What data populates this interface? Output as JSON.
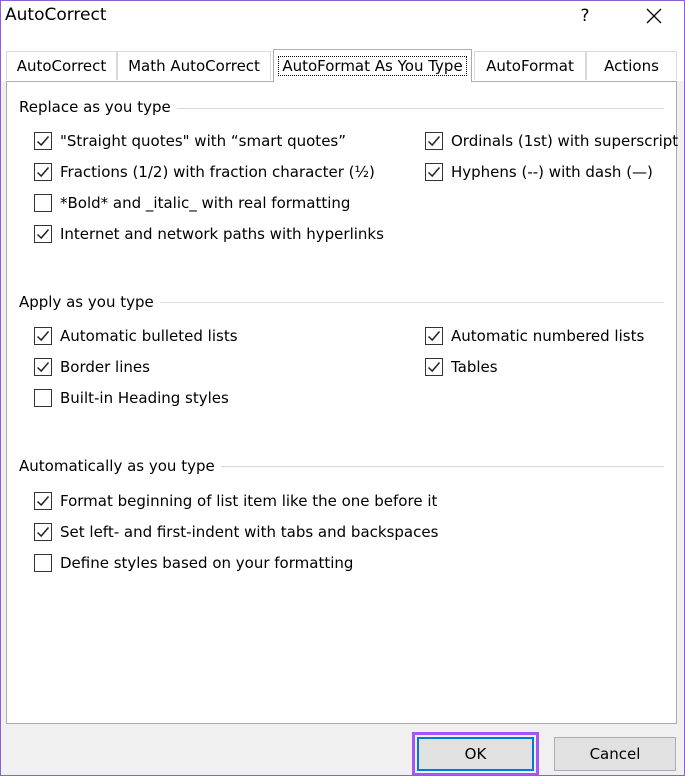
{
  "window": {
    "title": "AutoCorrect",
    "help_label": "?"
  },
  "tabs": [
    {
      "label": "AutoCorrect",
      "active": false
    },
    {
      "label": "Math AutoCorrect",
      "active": false
    },
    {
      "label": "AutoFormat As You Type",
      "active": true
    },
    {
      "label": "AutoFormat",
      "active": false
    },
    {
      "label": "Actions",
      "active": false
    }
  ],
  "groups": {
    "replace": {
      "title": "Replace as you type",
      "options": [
        {
          "label": "\"Straight quotes\" with “smart quotes”",
          "checked": true
        },
        {
          "label": "Fractions (1/2) with fraction character (½)",
          "checked": true
        },
        {
          "label": "*Bold* and _italic_ with real formatting",
          "checked": false
        },
        {
          "label": "Internet and network paths with hyperlinks",
          "checked": true
        },
        {
          "label": "Ordinals (1st) with superscript",
          "checked": true
        },
        {
          "label": "Hyphens (--) with dash (—)",
          "checked": true
        }
      ]
    },
    "apply": {
      "title": "Apply as you type",
      "options": [
        {
          "label": "Automatic bulleted lists",
          "checked": true
        },
        {
          "label": "Border lines",
          "checked": true
        },
        {
          "label": "Built-in Heading styles",
          "checked": false
        },
        {
          "label": "Automatic numbered lists",
          "checked": true
        },
        {
          "label": "Tables",
          "checked": true
        }
      ]
    },
    "auto": {
      "title": "Automatically as you type",
      "options": [
        {
          "label": "Format beginning of list item like the one before it",
          "checked": true
        },
        {
          "label": "Set left- and first-indent with tabs and backspaces",
          "checked": true
        },
        {
          "label": "Define styles based on your formatting",
          "checked": false
        }
      ]
    }
  },
  "buttons": {
    "ok_label": "OK",
    "cancel_label": "Cancel"
  },
  "colors": {
    "highlight": "#a855f7",
    "focus": "#0078d7"
  }
}
